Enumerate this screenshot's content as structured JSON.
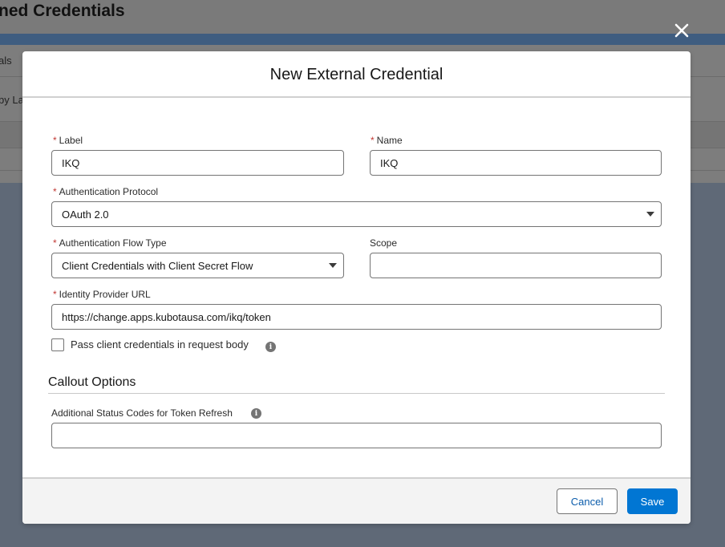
{
  "background": {
    "page_title": "ned Credentials",
    "tab_text": "als",
    "list_text": "by La"
  },
  "modal": {
    "title": "New External Credential",
    "close_icon": "close-icon",
    "fields": {
      "label": {
        "label": "Label",
        "value": "IKQ",
        "required": true
      },
      "name": {
        "label": "Name",
        "value": "IKQ",
        "required": true
      },
      "auth_protocol": {
        "label": "Authentication Protocol",
        "value": "OAuth 2.0",
        "required": true
      },
      "auth_flow_type": {
        "label": "Authentication Flow Type",
        "value": "Client Credentials with Client Secret Flow",
        "required": true
      },
      "scope": {
        "label": "Scope",
        "value": "",
        "required": false
      },
      "identity_provider_url": {
        "label": "Identity Provider URL",
        "value": "https://change.apps.kubotausa.com/ikq/token",
        "required": true
      },
      "pass_credentials": {
        "label": "Pass client credentials in request body",
        "checked": false
      }
    },
    "callout_section": {
      "title": "Callout Options",
      "status_codes": {
        "label": "Additional Status Codes for Token Refresh",
        "value": ""
      }
    },
    "footer": {
      "cancel_label": "Cancel",
      "save_label": "Save"
    },
    "required_marker": "*"
  },
  "colors": {
    "brand_blue": "#0176d3",
    "link_blue": "#0b5cab",
    "required_red": "#c23934",
    "overlay": "#5f6977"
  }
}
